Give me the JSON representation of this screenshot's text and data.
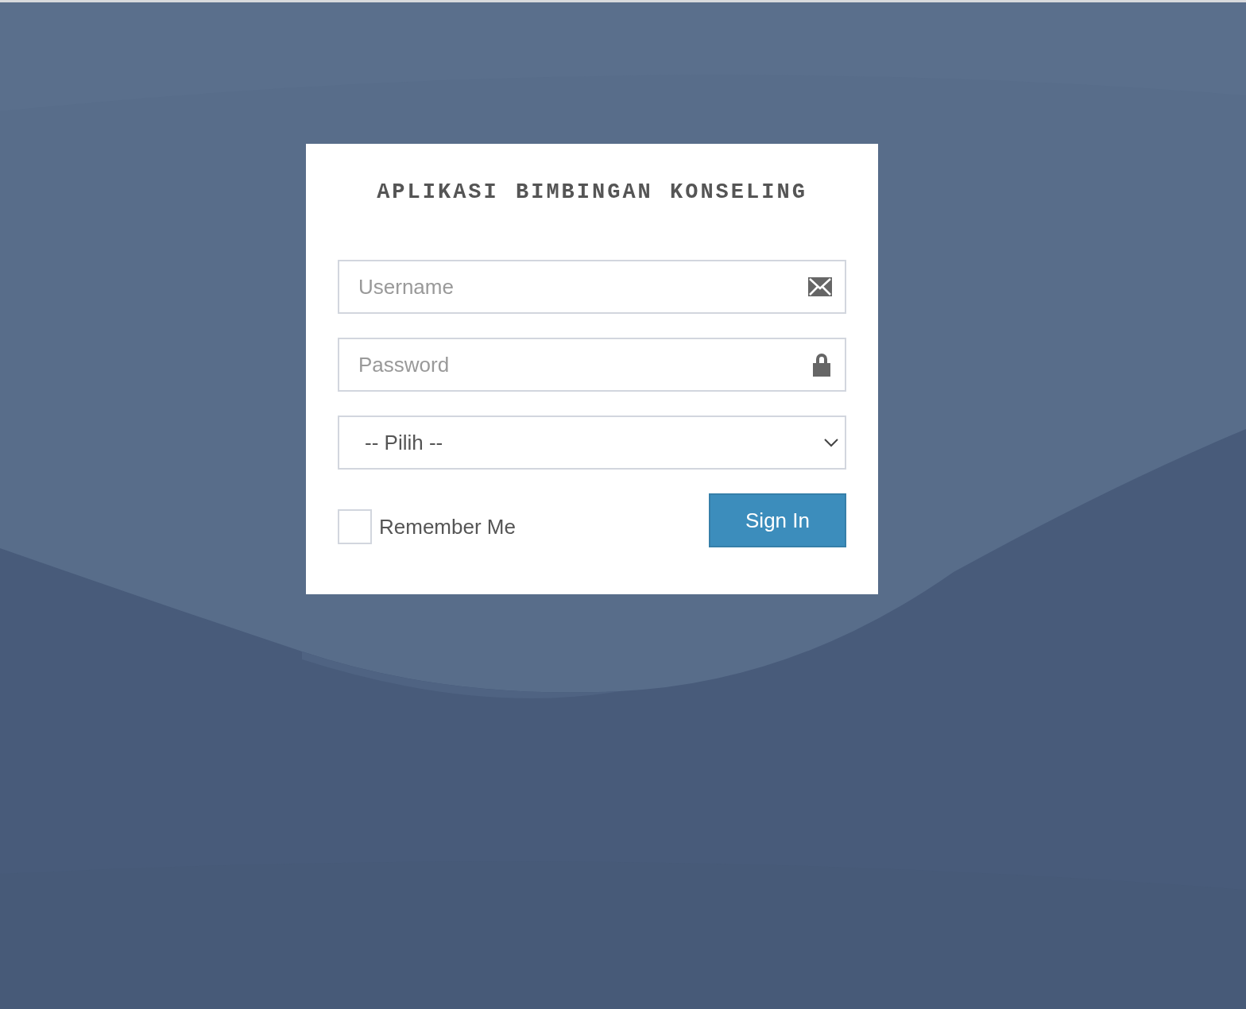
{
  "title": "APLIKASI BIMBINGAN KONSELING",
  "fields": [
    {
      "kind": "email",
      "placeholder": "Username"
    },
    {
      "kind": "password",
      "placeholder": "Password"
    }
  ],
  "role_select": {
    "value": "-- Pilih --"
  },
  "remember": {
    "label": "Remember Me",
    "checked": false
  },
  "submit": {
    "label": "Sign In"
  }
}
